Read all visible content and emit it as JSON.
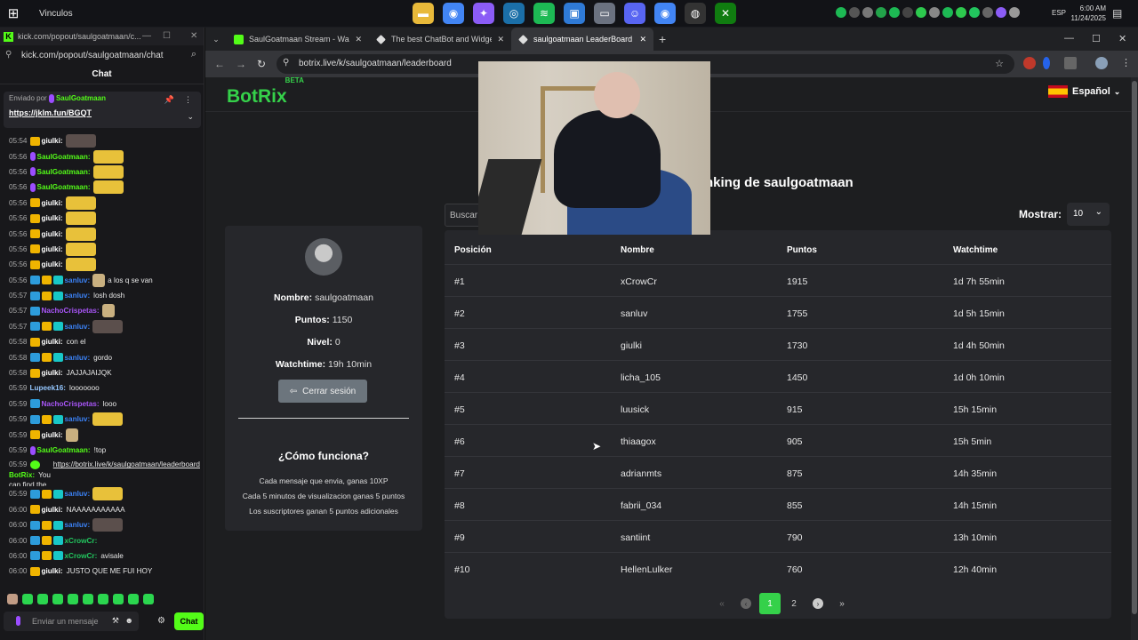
{
  "taskbar": {
    "start_icon": "windows-icon",
    "title": "Vinculos",
    "apps": [
      {
        "icon": "folder-icon",
        "color": "#e8b93a"
      },
      {
        "icon": "chrome-icon",
        "color": "#4285f4"
      },
      {
        "icon": "copilot-icon",
        "color": "#8b5cf6"
      },
      {
        "icon": "steam-icon",
        "color": "#1b6fa8"
      },
      {
        "icon": "spotify-icon",
        "color": "#1db954"
      },
      {
        "icon": "store-icon",
        "color": "#2f7ad6"
      },
      {
        "icon": "window-icon",
        "color": "#6b7280"
      },
      {
        "icon": "discord-icon",
        "color": "#5865f2"
      },
      {
        "icon": "chrome-icon",
        "color": "#4285f4"
      },
      {
        "icon": "obs-icon",
        "color": "#333"
      },
      {
        "icon": "xbox-icon",
        "color": "#107c10"
      }
    ],
    "lang": "ESP",
    "time": "6:00 AM",
    "date": "11/24/2025"
  },
  "chat_window": {
    "tab_title": "kick.com/popout/saulgoatmaan/c...",
    "url": "kick.com/popout/saulgoatmaan/chat",
    "header": "Chat",
    "pinned": {
      "prefix": "Enviado por",
      "user": "SaulGoatmaan",
      "link": "https://jklm.fun/BGQT"
    },
    "messages": [
      {
        "time": "05:54",
        "badges": [
          "crown"
        ],
        "user": "giulki:",
        "color": "#ffffff",
        "emote": "dark",
        "text": ""
      },
      {
        "time": "05:56",
        "badges": [
          "mic"
        ],
        "user": "SaulGoatmaan:",
        "color": "#53fc18",
        "emote": "yellow",
        "text": ""
      },
      {
        "time": "05:56",
        "badges": [
          "mic"
        ],
        "user": "SaulGoatmaan:",
        "color": "#53fc18",
        "emote": "yellow",
        "text": ""
      },
      {
        "time": "05:56",
        "badges": [
          "mic"
        ],
        "user": "SaulGoatmaan:",
        "color": "#53fc18",
        "emote": "yellow",
        "text": ""
      },
      {
        "time": "05:56",
        "badges": [
          "crown"
        ],
        "user": "giulki:",
        "color": "#ffffff",
        "emote": "yellow",
        "text": ""
      },
      {
        "time": "05:56",
        "badges": [
          "crown"
        ],
        "user": "giulki:",
        "color": "#ffffff",
        "emote": "yellow",
        "text": ""
      },
      {
        "time": "05:56",
        "badges": [
          "crown"
        ],
        "user": "giulki:",
        "color": "#ffffff",
        "emote": "yellow",
        "text": ""
      },
      {
        "time": "05:56",
        "badges": [
          "crown"
        ],
        "user": "giulki:",
        "color": "#ffffff",
        "emote": "yellow",
        "text": ""
      },
      {
        "time": "05:56",
        "badges": [
          "crown"
        ],
        "user": "giulki:",
        "color": "#ffffff",
        "emote": "yellow",
        "text": ""
      },
      {
        "time": "05:56",
        "badges": [
          "ar",
          "crown",
          "gift"
        ],
        "user": "sanluv:",
        "color": "#3b82f6",
        "emote": "small",
        "text": "a los q se van"
      },
      {
        "time": "05:57",
        "badges": [
          "ar",
          "crown",
          "gift"
        ],
        "user": "sanluv:",
        "color": "#3b82f6",
        "emote": "",
        "text": "losh dosh"
      },
      {
        "time": "05:57",
        "badges": [
          "ar"
        ],
        "user": "NachoCrispetas:",
        "color": "#a855f7",
        "emote": "small",
        "text": ""
      },
      {
        "time": "05:57",
        "badges": [
          "ar",
          "crown",
          "gift"
        ],
        "user": "sanluv:",
        "color": "#3b82f6",
        "emote": "dark",
        "text": ""
      },
      {
        "time": "05:58",
        "badges": [
          "crown"
        ],
        "user": "giulki:",
        "color": "#ffffff",
        "emote": "",
        "text": "con el"
      },
      {
        "time": "05:58",
        "badges": [
          "ar",
          "crown",
          "gift"
        ],
        "user": "sanluv:",
        "color": "#3b82f6",
        "emote": "",
        "text": "gordo"
      },
      {
        "time": "05:58",
        "badges": [
          "crown"
        ],
        "user": "giulki:",
        "color": "#ffffff",
        "emote": "",
        "text": "JAJJAJAIJQK"
      },
      {
        "time": "05:59",
        "badges": [],
        "user": "Lupeek16:",
        "color": "#93c5fd",
        "emote": "",
        "text": "looooooo"
      },
      {
        "time": "05:59",
        "badges": [
          "ar"
        ],
        "user": "NachoCrispetas:",
        "color": "#a855f7",
        "emote": "",
        "text": "looo"
      },
      {
        "time": "05:59",
        "badges": [
          "ar",
          "crown",
          "gift"
        ],
        "user": "sanluv:",
        "color": "#3b82f6",
        "emote": "yellow",
        "text": ""
      },
      {
        "time": "05:59",
        "badges": [
          "crown"
        ],
        "user": "giulki:",
        "color": "#ffffff",
        "emote": "small",
        "text": ""
      },
      {
        "time": "05:59",
        "badges": [
          "mic"
        ],
        "user": "SaulGoatmaan:",
        "color": "#53fc18",
        "emote": "",
        "text": "!top"
      },
      {
        "time": "05:59",
        "badges": [
          "bot"
        ],
        "user": "BotRix:",
        "color": "#53fc18",
        "emote": "",
        "text": "You can find the list of users that supported the most:",
        "link": "https://botrix.live/k/saulgoatmaan/leaderboard"
      },
      {
        "time": "05:59",
        "badges": [
          "ar",
          "crown",
          "gift"
        ],
        "user": "sanluv:",
        "color": "#3b82f6",
        "emote": "yellow",
        "text": ""
      },
      {
        "time": "06:00",
        "badges": [
          "crown"
        ],
        "user": "giulki:",
        "color": "#ffffff",
        "emote": "",
        "text": "NAAAAAAAAAAA"
      },
      {
        "time": "06:00",
        "badges": [
          "ar",
          "crown",
          "gift"
        ],
        "user": "sanluv:",
        "color": "#3b82f6",
        "emote": "dark",
        "text": ""
      },
      {
        "time": "06:00",
        "badges": [
          "ar",
          "crown",
          "gift"
        ],
        "user": "xCrowCr:",
        "color": "#22c55e",
        "emote": "",
        "text": ""
      },
      {
        "time": "06:00",
        "badges": [
          "ar",
          "crown",
          "gift"
        ],
        "user": "xCrowCr:",
        "color": "#22c55e",
        "emote": "",
        "text": "avisale"
      },
      {
        "time": "06:00",
        "badges": [
          "crown"
        ],
        "user": "giulki:",
        "color": "#ffffff",
        "emote": "",
        "text": "JUSTO QUE ME FUI HOY"
      }
    ],
    "input_placeholder": "Enviar un mensaje",
    "chat_button": "Chat"
  },
  "browser": {
    "tabs": [
      {
        "title": "SaulGoatmaan Stream - Wa",
        "favicon_color": "#53fc18",
        "active": false
      },
      {
        "title": "The best ChatBot and Widgets",
        "favicon_color": "#dddddd",
        "active": false
      },
      {
        "title": "saulgoatmaan LeaderBoard | Th",
        "favicon_color": "#dddddd",
        "active": true
      }
    ],
    "url": "botrix.live/k/saulgoatmaan/leaderboard"
  },
  "site": {
    "logo": "BotRix",
    "logo_badge": "BETA",
    "language": "Español",
    "ranking_title": "nking de saulgoatmaan",
    "search_placeholder": "Buscar",
    "show_label": "Mostrar:",
    "show_value": "10",
    "profile": {
      "name_label": "Nombre:",
      "name": "saulgoatmaan",
      "points_label": "Puntos:",
      "points": "1150",
      "level_label": "Nivel:",
      "level": "0",
      "watchtime_label": "Watchtime:",
      "watchtime": "19h 10min",
      "logout": "Cerrar sesión",
      "how_title": "¿Cómo funciona?",
      "rules": [
        "Cada mensaje que envia, ganas 10XP",
        "Cada 5 minutos de visualizacion ganas 5 puntos",
        "Los suscriptores ganan 5 puntos adicionales"
      ]
    },
    "table": {
      "headers": [
        "Posición",
        "Nombre",
        "Puntos",
        "Watchtime"
      ],
      "rows": [
        [
          "#1",
          "xCrowCr",
          "1915",
          "1d 7h 55min"
        ],
        [
          "#2",
          "sanluv",
          "1755",
          "1d 5h 15min"
        ],
        [
          "#3",
          "giulki",
          "1730",
          "1d 4h 50min"
        ],
        [
          "#4",
          "licha_105",
          "1450",
          "1d 0h 10min"
        ],
        [
          "#5",
          "luusick",
          "915",
          "15h 15min"
        ],
        [
          "#6",
          "thiaagox",
          "905",
          "15h 5min"
        ],
        [
          "#7",
          "adrianmts",
          "875",
          "14h 35min"
        ],
        [
          "#8",
          "fabrii_034",
          "855",
          "14h 15min"
        ],
        [
          "#9",
          "santiint",
          "790",
          "13h 10min"
        ],
        [
          "#10",
          "HellenLulker",
          "760",
          "12h 40min"
        ]
      ]
    },
    "pagination": {
      "pages": [
        "1",
        "2"
      ],
      "current": "1"
    }
  }
}
